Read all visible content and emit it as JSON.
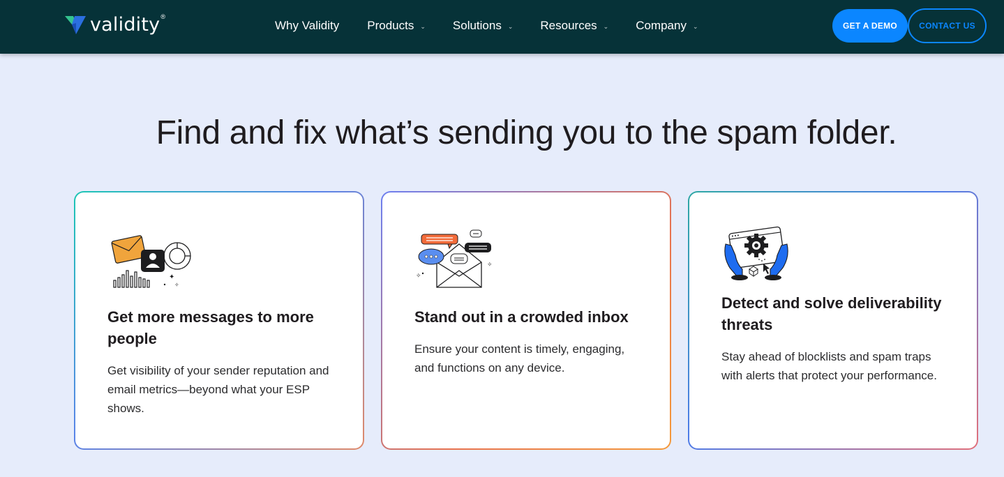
{
  "brand": {
    "name": "validity",
    "reg": "®"
  },
  "nav": {
    "items": [
      {
        "label": "Why Validity",
        "has_dropdown": false
      },
      {
        "label": "Products",
        "has_dropdown": true
      },
      {
        "label": "Solutions",
        "has_dropdown": true
      },
      {
        "label": "Resources",
        "has_dropdown": true
      },
      {
        "label": "Company",
        "has_dropdown": true
      }
    ],
    "demo_button": "GET A DEMO",
    "contact_button": "CONTACT US",
    "dropdown_icon": "chevron-down-icon"
  },
  "hero": {
    "headline": "Find and fix what’s sending you to the spam folder."
  },
  "cards": [
    {
      "icon": "email-metrics-illustration",
      "title": "Get more messages to more people",
      "body": "Get visibility of your sender reputation and email metrics—beyond what your ESP shows."
    },
    {
      "icon": "inbox-chat-illustration",
      "title": "Stand out in a crowded inbox",
      "body": "Ensure your content is timely, engaging, and functions on any device."
    },
    {
      "icon": "hands-gear-illustration",
      "title": "Detect and solve deliverability threats",
      "body": "Stay ahead of blocklists and spam traps with alerts that protect your performance."
    }
  ],
  "colors": {
    "nav_bg": "#063238",
    "page_bg": "#e6ecfb",
    "accent_blue": "#0b86ff",
    "illus_orange": "#f0a43c",
    "illus_coral": "#f26b3a",
    "illus_blue": "#1e6cf0"
  }
}
